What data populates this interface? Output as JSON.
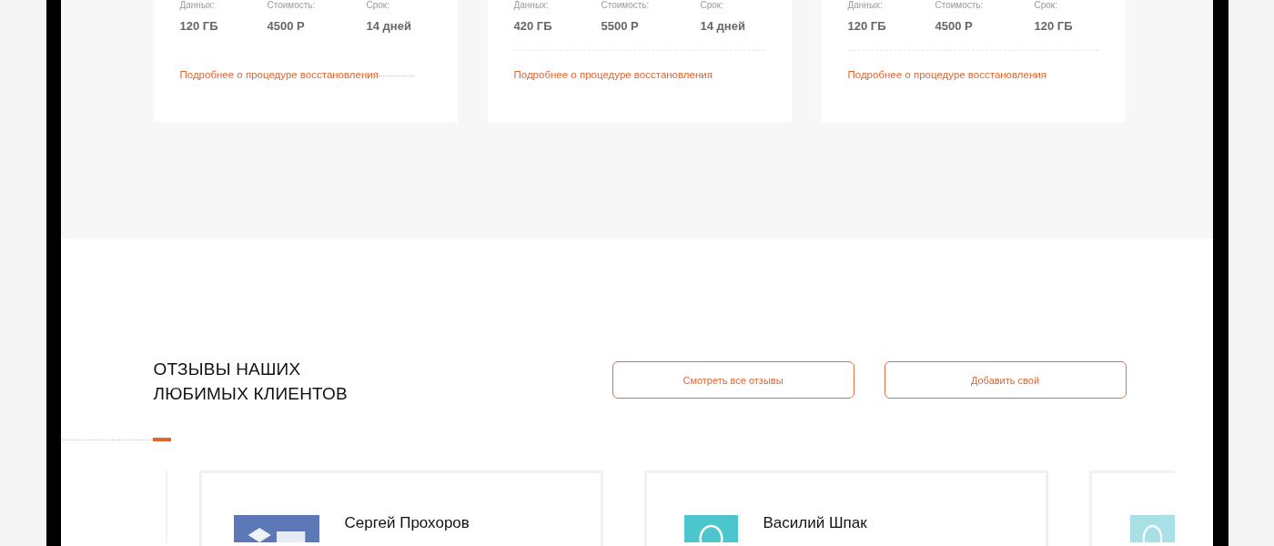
{
  "plans": [
    {
      "divider": false,
      "stats": [
        {
          "label": "Данных:",
          "value": "120 ГБ"
        },
        {
          "label": "Стоимость:",
          "value": "4500 Р"
        },
        {
          "label": "Срок:",
          "value": "14 дней"
        }
      ],
      "link": "Подробнее о процедуре восстановления"
    },
    {
      "divider": true,
      "stats": [
        {
          "label": "Данных:",
          "value": "420 ГБ"
        },
        {
          "label": "Стоимость:",
          "value": "5500 Р"
        },
        {
          "label": "Срок:",
          "value": "14 дней"
        }
      ],
      "link": "Подробнее о процедуре восстановления"
    },
    {
      "divider": true,
      "stats": [
        {
          "label": "Данных:",
          "value": "120 ГБ"
        },
        {
          "label": "Стоимость:",
          "value": "4500 Р"
        },
        {
          "label": "Срок:",
          "value": "120 ГБ"
        }
      ],
      "link": "Подробнее о процедуре восстановления"
    }
  ],
  "reviews": {
    "title_lines": [
      "ОТЗЫВЫ НАШИХ",
      "ЛЮБИМЫХ КЛИЕНТОВ"
    ],
    "buttons": [
      "Смотреть все отзывы",
      "Добавить свой"
    ],
    "cards": [
      {
        "name": "Сергей Прохоров",
        "kind": "logo",
        "color": "#5d78b6"
      },
      {
        "name": "Василий Шпак",
        "kind": "avatar",
        "color": "#4cc6cc"
      },
      {
        "kind": "avatar",
        "color": "#a8e0e8"
      }
    ]
  }
}
